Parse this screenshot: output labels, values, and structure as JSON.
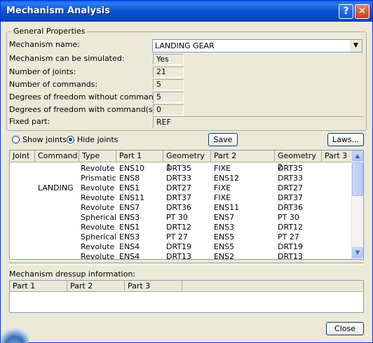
{
  "window": {
    "title": "Mechanism Analysis"
  },
  "icons": {
    "help": "help-icon",
    "close": "close-icon",
    "dropdown": "chevron-down-icon",
    "scroll_up": "scroll-up-arrow-icon",
    "scroll_down": "scroll-down-arrow-icon"
  },
  "general": {
    "group_label": "General Properties",
    "mechanism_name_label": "Mechanism name:",
    "mechanism_name_value": "LANDING GEAR",
    "can_simulate_label": "Mechanism can be simulated:",
    "can_simulate_value": "Yes",
    "num_joints_label": "Number of joints:",
    "num_joints_value": "21",
    "num_commands_label": "Number of commands:",
    "num_commands_value": "5",
    "dof_without_label": "Degrees of freedom without command(s):",
    "dof_without_value": "5",
    "dof_with_label": "Degrees of freedom with command(s):",
    "dof_with_value": "0",
    "fixed_part_label": "Fixed part:",
    "fixed_part_value": "REF"
  },
  "options": {
    "show_joints_label": "Show joints",
    "hide_joints_label": "Hide joints",
    "selected": "Hide joints",
    "save_label": "Save",
    "laws_label": "Laws..."
  },
  "joints_table": {
    "columns": [
      "Joint",
      "Command",
      "Type",
      "Part 1",
      "Geometry 1",
      "Part 2",
      "Geometry 2",
      "Part 3"
    ],
    "rows": [
      [
        "",
        "",
        "Revolute",
        "ENS10",
        "DRT35",
        "FIXE",
        "DRT35",
        ""
      ],
      [
        "",
        "",
        "Prismatic",
        "ENS8",
        "DRT33",
        "ENS12",
        "DRT33",
        ""
      ],
      [
        "",
        "LANDING",
        "Revolute",
        "ENS1",
        "DRT27",
        "FIXE",
        "DRT27",
        ""
      ],
      [
        "",
        "",
        "Revolute",
        "ENS11",
        "DRT37",
        "FIXE",
        "DRT37",
        ""
      ],
      [
        "",
        "",
        "Revolute",
        "ENS7",
        "DRT36",
        "ENS11",
        "DRT36",
        ""
      ],
      [
        "",
        "",
        "Spherical",
        "ENS3",
        "PT 30",
        "ENS7",
        "PT 30",
        ""
      ],
      [
        "",
        "",
        "Revolute",
        "ENS1",
        "DRT12",
        "ENS3",
        "DRT12",
        ""
      ],
      [
        "",
        "",
        "Spherical",
        "ENS3",
        "PT 27",
        "ENS5",
        "PT 27",
        ""
      ],
      [
        "",
        "",
        "Revolute",
        "ENS4",
        "DRT19",
        "ENS5",
        "DRT19",
        ""
      ],
      [
        "",
        "",
        "Revolute",
        "ENS4",
        "DRT13",
        "ENS2",
        "DRT13",
        ""
      ]
    ]
  },
  "dressup": {
    "label": "Mechanism dressup information:",
    "columns": [
      "Part 1",
      "Part 2",
      "Part 3"
    ]
  },
  "footer": {
    "close_label": "Close"
  }
}
